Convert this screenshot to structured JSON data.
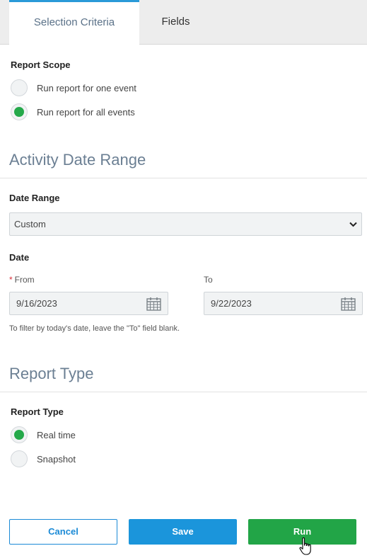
{
  "tabs": [
    {
      "label": "Selection Criteria",
      "active": true
    },
    {
      "label": "Fields",
      "active": false
    }
  ],
  "report_scope": {
    "label": "Report Scope",
    "options": [
      {
        "label": "Run report for one event",
        "checked": false
      },
      {
        "label": "Run report for all events",
        "checked": true
      }
    ]
  },
  "activity_date_range": {
    "heading": "Activity Date Range",
    "date_range_label": "Date Range",
    "date_range_value": "Custom",
    "date_label": "Date",
    "from_required": "*",
    "from_label": "From",
    "from_value": "9/16/2023",
    "to_label": "To",
    "to_value": "9/22/2023",
    "hint": "To filter by today's date, leave the \"To\" field blank."
  },
  "report_type": {
    "heading": "Report Type",
    "label": "Report Type",
    "options": [
      {
        "label": "Real time",
        "checked": true
      },
      {
        "label": "Snapshot",
        "checked": false
      }
    ]
  },
  "actions": {
    "cancel_label": "Cancel",
    "save_label": "Save",
    "run_label": "Run"
  },
  "colors": {
    "accent_blue": "#1b95db",
    "run_green": "#22a547",
    "radio_green": "#25a94a",
    "heading_gray": "#6b7f93",
    "required_red": "#d9303a"
  }
}
